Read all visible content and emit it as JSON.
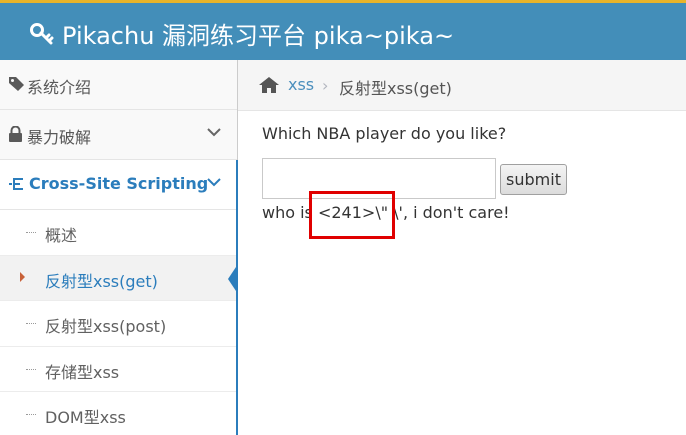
{
  "header": {
    "title": "Pikachu 漏洞练习平台 pika~pika~",
    "accent_color": "#438eb9"
  },
  "sidebar": {
    "items": [
      {
        "label": "系统介绍",
        "icon": "tags-icon"
      },
      {
        "label": "暴力破解",
        "icon": "lock-icon"
      },
      {
        "label": "Cross-Site Scripting",
        "icon": "list-icon"
      }
    ],
    "sub_items": [
      {
        "label": "概述"
      },
      {
        "label": "反射型xss(get)"
      },
      {
        "label": "反射型xss(post)"
      },
      {
        "label": "存储型xss"
      },
      {
        "label": "DOM型xss"
      }
    ]
  },
  "breadcrumb": {
    "section": "xss",
    "separator": "›",
    "current": "反射型xss(get)"
  },
  "main": {
    "question": "Which NBA player do you like?",
    "input_value": "",
    "submit_label": "submit",
    "result_text": "who is <241>\\\" \\', i don't care!"
  }
}
